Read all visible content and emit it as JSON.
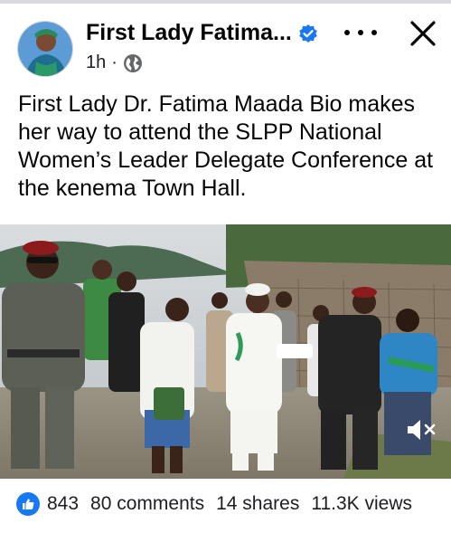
{
  "post": {
    "author": "First Lady Fatima...",
    "verified": true,
    "time": "1h",
    "separator": "·",
    "audience_icon": "globe-icon",
    "text": "First Lady Dr. Fatima Maada Bio makes her way to attend the SLPP National Women’s Leader Delegate Conference at the kenema Town Hall.",
    "media_type": "video",
    "media_description_icon": "video-thumbnail"
  },
  "header": {
    "more_icon": "more-options-icon",
    "close_icon": "close-icon"
  },
  "media": {
    "mute_icon": "volume-muted-icon"
  },
  "footer": {
    "reactions": "843",
    "comments": "80 comments",
    "shares": "14 shares",
    "views": "11.3K views"
  },
  "colors": {
    "facebook_blue": "#1877f2",
    "text": "#050505",
    "secondary_text": "#1c1e21"
  }
}
